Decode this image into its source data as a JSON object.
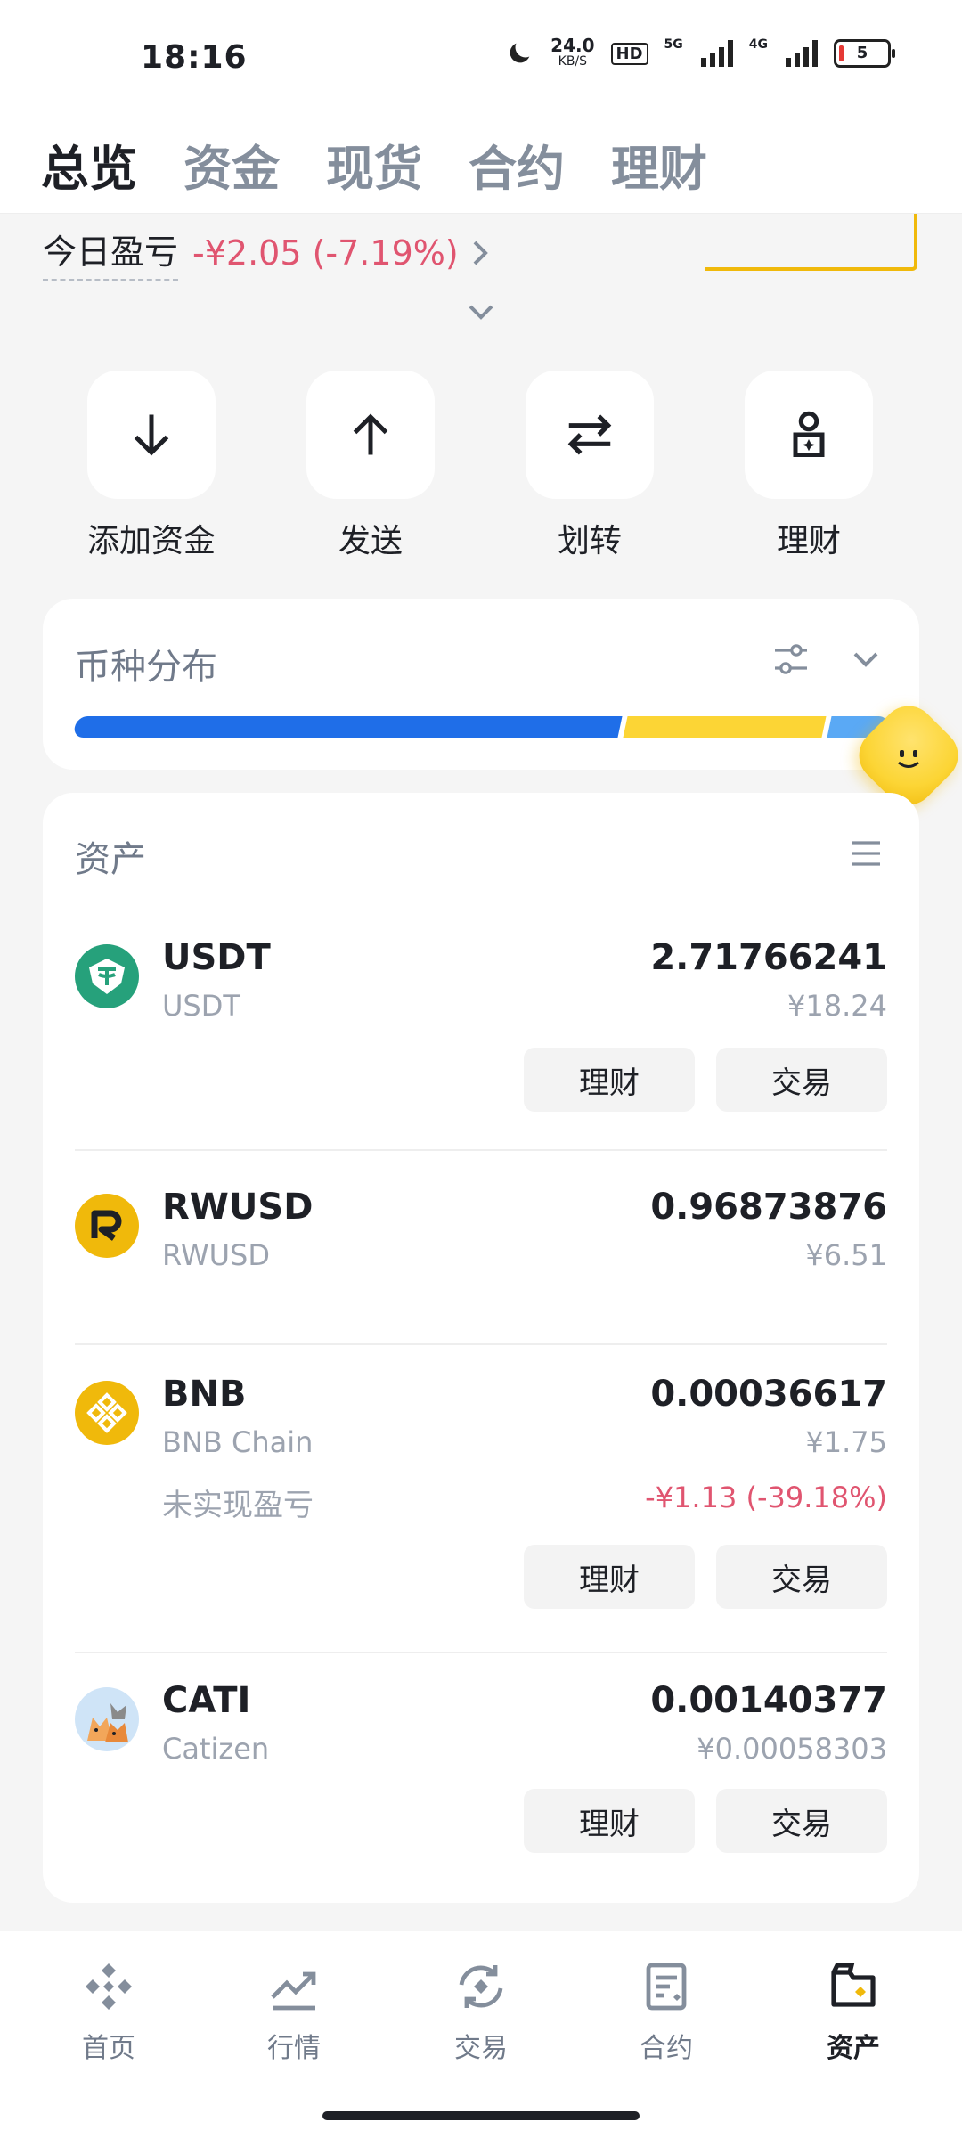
{
  "status_bar": {
    "time": "18:16",
    "net_speed": "24.0",
    "net_unit": "KB/S",
    "hd_badge": "HD",
    "sig1_label": "5G",
    "sig2_label": "4G",
    "battery": "5"
  },
  "top_tabs": [
    {
      "label": "总览",
      "active": true
    },
    {
      "label": "资金",
      "active": false
    },
    {
      "label": "现货",
      "active": false
    },
    {
      "label": "合约",
      "active": false
    },
    {
      "label": "理财",
      "active": false
    }
  ],
  "pnl": {
    "label": "今日盈亏",
    "value": "-¥2.05 (-7.19%)"
  },
  "actions": [
    {
      "label": "添加资金",
      "icon": "arrow-down-icon"
    },
    {
      "label": "发送",
      "icon": "arrow-up-icon"
    },
    {
      "label": "划转",
      "icon": "transfer-icon"
    },
    {
      "label": "理财",
      "icon": "earn-icon"
    }
  ],
  "distribution": {
    "title": "币种分布",
    "segments": [
      {
        "share": 0.66,
        "color": "#1f6ee8"
      },
      {
        "share": 0.24,
        "color": "#fcd535"
      },
      {
        "share": 0.07,
        "color": "#5aa9f5"
      }
    ]
  },
  "assets": {
    "title": "资产",
    "earn_label": "理财",
    "trade_label": "交易",
    "items": [
      {
        "symbol": "USDT",
        "name": "USDT",
        "qty": "2.71766241",
        "fiat": "¥18.24",
        "unrealized_label": "",
        "unrealized": "",
        "buttons": true
      },
      {
        "symbol": "RWUSD",
        "name": "RWUSD",
        "qty": "0.96873876",
        "fiat": "¥6.51",
        "unrealized_label": "",
        "unrealized": "",
        "buttons": false
      },
      {
        "symbol": "BNB",
        "name": "BNB Chain",
        "qty": "0.00036617",
        "fiat": "¥1.75",
        "unrealized_label": "未实现盈亏",
        "unrealized": "-¥1.13 (-39.18%)",
        "buttons": true
      },
      {
        "symbol": "CATI",
        "name": "Catizen",
        "qty": "0.00140377",
        "fiat": "¥0.00058303",
        "unrealized_label": "",
        "unrealized": "",
        "buttons": true
      }
    ]
  },
  "bottom_nav": [
    {
      "label": "首页",
      "icon": "home-icon",
      "active": false
    },
    {
      "label": "行情",
      "icon": "markets-icon",
      "active": false
    },
    {
      "label": "交易",
      "icon": "trade-icon",
      "active": false
    },
    {
      "label": "合约",
      "icon": "futures-icon",
      "active": false
    },
    {
      "label": "资产",
      "icon": "wallet-icon",
      "active": true
    }
  ],
  "colors": {
    "accent": "#f0b90b",
    "loss": "#e05570",
    "text": "#1e2026",
    "muted": "#9ca3af"
  }
}
